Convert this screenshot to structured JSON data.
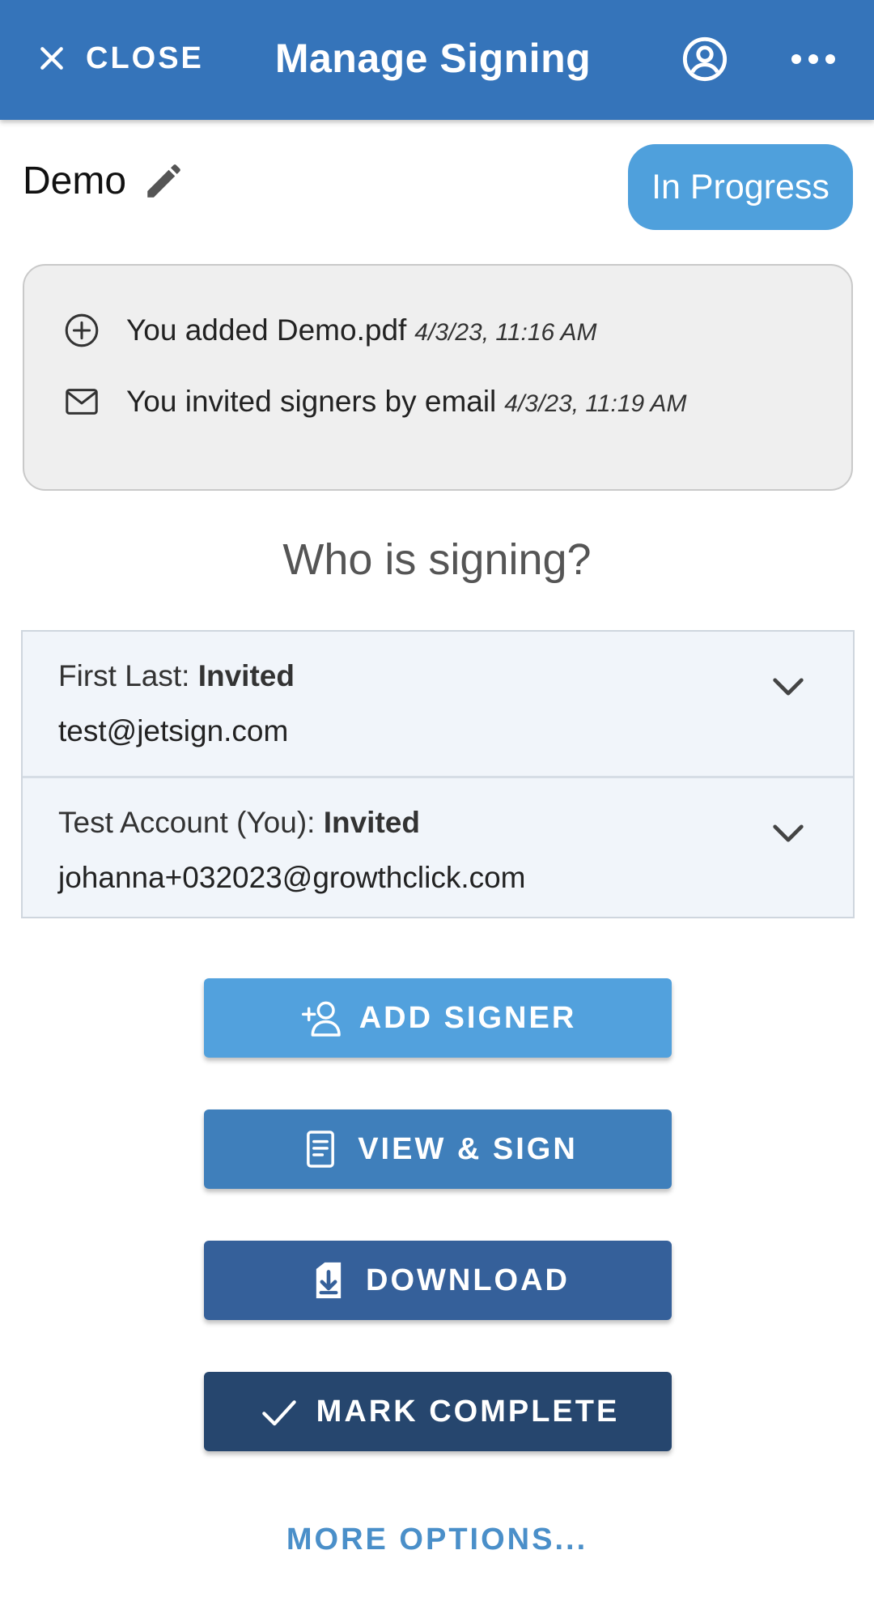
{
  "appbar": {
    "close_label": "CLOSE",
    "title": "Manage Signing",
    "background": "#3574ba"
  },
  "document": {
    "name": "Demo",
    "status": "In Progress"
  },
  "activity": [
    {
      "icon": "plus-circle-icon",
      "text": "You added Demo.pdf",
      "time": "4/3/23, 11:16 AM"
    },
    {
      "icon": "mail-icon",
      "text": "You invited signers by email",
      "time": "4/3/23, 11:19 AM"
    }
  ],
  "signers_section": {
    "title": "Who is signing?",
    "signers": [
      {
        "name": "First Last:",
        "status": "Invited",
        "email": "test@jetsign.com"
      },
      {
        "name": "Test Account (You):",
        "status": "Invited",
        "email": "johanna+032023@growthclick.com"
      }
    ]
  },
  "actions": {
    "add_signer": "ADD SIGNER",
    "view_sign": "VIEW & SIGN",
    "download": "DOWNLOAD",
    "mark_complete": "MARK COMPLETE",
    "more_options": "MORE OPTIONS..."
  },
  "colors": {
    "accent_light": "#52a1dd",
    "accent_mid": "#3f7fbb",
    "accent_dark": "#35609a",
    "accent_darkest": "#26466e",
    "status_badge": "#4fa0dc"
  }
}
